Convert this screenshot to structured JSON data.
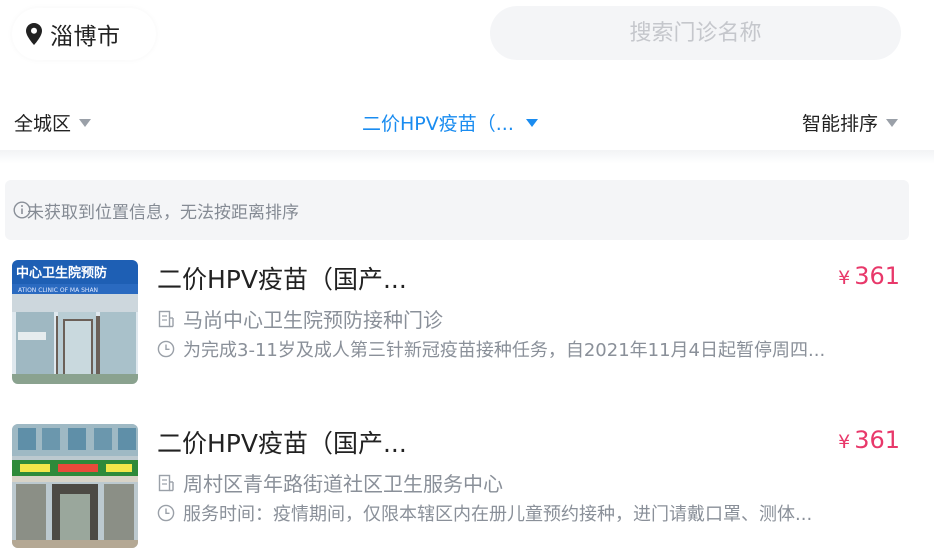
{
  "header": {
    "city": "淄博市",
    "search_placeholder": "搜索门诊名称"
  },
  "filters": {
    "area": "全城区",
    "vaccine": "二价HPV疫苗（...",
    "sort": "智能排序"
  },
  "notice": "未获取到位置信息，无法按距离排序",
  "clinics": [
    {
      "title": "二价HPV疫苗（国产...",
      "price": "361",
      "currency": "¥",
      "clinic_name": "马尚中心卫生院预防接种门诊",
      "description": "为完成3-11岁及成人第三针新冠疫苗接种任务，自2021年11月4日起暂停周四...",
      "photo_sign_text": "中心卫生院预防"
    },
    {
      "title": "二价HPV疫苗（国产...",
      "price": "361",
      "currency": "¥",
      "clinic_name": "周村区青年路街道社区卫生服务中心",
      "description": "服务时间：疫情期间，仅限本辖区内在册儿童预约接种，进门请戴口罩、测体..."
    }
  ],
  "colors": {
    "accent_blue": "#1a8cf0",
    "price_red": "#e8386a",
    "muted_text": "#8a9099",
    "notice_bg": "#f4f5f7"
  }
}
